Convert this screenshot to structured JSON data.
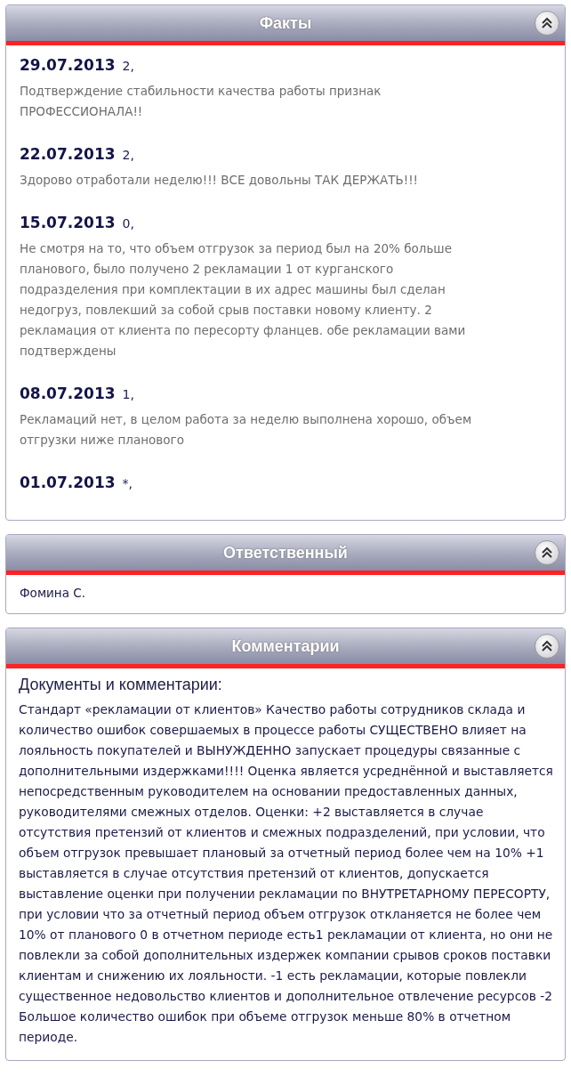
{
  "facts": {
    "title": "Факты",
    "entries": [
      {
        "date": "29.07.2013",
        "score": "2,",
        "text": "Подтверждение стабильности качества работы признак ПРОФЕССИОНАЛА!!"
      },
      {
        "date": "22.07.2013",
        "score": "2,",
        "text": "Здорово отработали неделю!!! ВСЕ довольны ТАК ДЕРЖАТЬ!!!"
      },
      {
        "date": "15.07.2013",
        "score": "0,",
        "text": "Не смотря на то, что объем отгрузок за период был на 20% больше планового, было получено 2 рекламации 1 от курганского подразделения при комплектации в их адрес машины был сделан недогруз, повлекший за собой срыв поставки новому клиенту. 2 рекламация от клиента по пересорту фланцев. обе рекламации вами подтверждены"
      },
      {
        "date": "08.07.2013",
        "score": "1,",
        "text": "Рекламаций нет, в целом работа за неделю выполнена хорошо, объем отгрузки ниже планового"
      },
      {
        "date": "01.07.2013",
        "score": "*,"
      }
    ]
  },
  "responsible": {
    "title": "Ответственный",
    "name": "Фомина С."
  },
  "comments": {
    "title": "Комментарии",
    "heading": "Документы и комментарии:",
    "text": "Стандарт «рекламации от клиентов» Качество работы сотрудников склада и количество ошибок совершаемых в процессе работы СУЩЕСТВЕНО влияет на лояльность покупателей и ВЫНУЖДЕННО запускает процедуры связанные с дополнительными издержками!!!! Оценка является усреднённой и выставляется непосредственным руководителем на основании предоставленных данных, руководителями смежных отделов. Оценки: +2 выставляется в случае отсутствия претензий от клиентов и смежных подразделений, при условии, что объем отгрузок превышает плановый за отчетный период более чем на 10% +1 выставляется в случае отсутствия претензий от клиентов, допускается выставление оценки при получении рекламации по ВНУТРЕТАРНОМУ ПЕРЕСОРТУ, при условии что за отчетный период объем отгрузок откланяется не более чем 10% от планового 0 в отчетном периоде есть1 рекламации от клиента, но они не повлекли за собой дополнительных издержек компании срывов сроков поставки клиентам и снижению их лояльности. -1 есть рекламации, которые повлекли существенное недовольство клиентов и дополнительное отвлечение ресурсов -2 Большое количество ошибок при объеме отгрузок меньше 80% в отчетном периоде."
  }
}
